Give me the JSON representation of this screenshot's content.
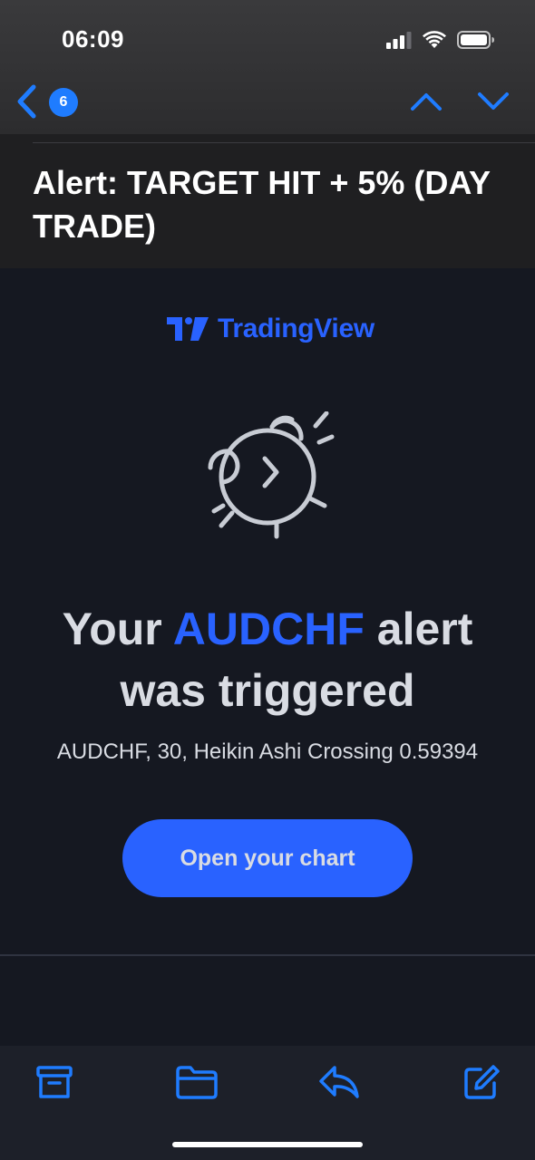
{
  "status_bar": {
    "time": "06:09"
  },
  "nav": {
    "unread_count": "6"
  },
  "subject": "Alert: TARGET HIT + 5% (DAY TRADE)",
  "email": {
    "brand": "TradingView",
    "headline_prefix": "Your ",
    "headline_symbol": "AUDCHF",
    "headline_suffix": " alert",
    "headline_line2": "was triggered",
    "detail": "AUDCHF, 30, Heikin Ashi Crossing 0.59394",
    "cta_label": "Open your chart"
  },
  "colors": {
    "accent": "#2962ff",
    "ios_blue": "#1f7cff",
    "background": "#151821",
    "text": "#d9dce3"
  },
  "icons": {
    "back": "chevron-left-icon",
    "up": "chevron-up-icon",
    "down": "chevron-down-icon",
    "clock": "alarm-clock-icon",
    "archive": "archive-icon",
    "folder": "folder-icon",
    "reply": "reply-icon",
    "compose": "compose-icon"
  }
}
